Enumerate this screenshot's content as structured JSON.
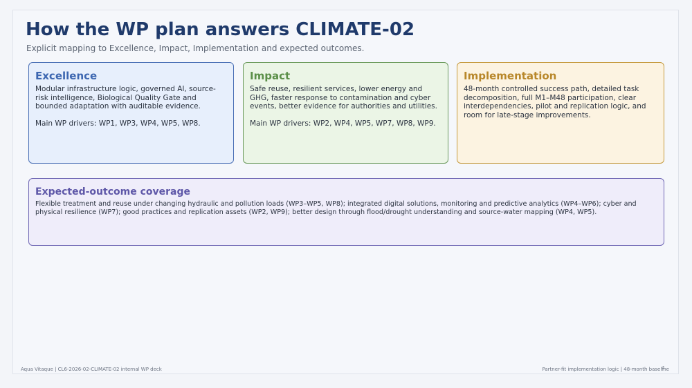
{
  "slide": {
    "title": "How the WP plan answers CLIMATE-02",
    "subtitle": "Explicit mapping to Excellence, Impact, Implementation and expected outcomes."
  },
  "cards": {
    "excellence": {
      "heading": "Excellence",
      "body": "Modular infrastructure logic, governed AI, source-risk intelligence, Biological Quality Gate and bounded adaptation with auditable evidence.",
      "drivers": "Main WP drivers: WP1, WP3, WP4, WP5, WP8.",
      "accent": "#3d67b1"
    },
    "impact": {
      "heading": "Impact",
      "body": "Safe reuse, resilient services, lower energy and GHG, faster response to contamination and cyber events, better evidence for authorities and utilities.",
      "drivers": "Main WP drivers: WP2, WP4, WP5, WP7, WP8, WP9.",
      "accent": "#5b8f48"
    },
    "implementation": {
      "heading": "Implementation",
      "body": "48-month controlled success path, detailed task decomposition, full M1–M48 participation, clear interdependencies, pilot and replication logic, and room for late-stage improvements.",
      "accent": "#b8872a"
    },
    "outcome": {
      "heading": "Expected-outcome coverage",
      "body": "Flexible treatment and reuse under changing hydraulic and pollution loads (WP3–WP5, WP8); integrated digital solutions, monitoring and predictive analytics (WP4–WP6); cyber and physical resilience (WP7); good practices and replication assets (WP2, WP9); better design through flood/drought understanding and source-water mapping (WP4, WP5).",
      "accent": "#5e57a8"
    }
  },
  "footer": {
    "left": "Aqua Vitaque | CL6-2026-02-CLIMATE-02 internal WP deck",
    "right": "Partner-fit implementation logic | 48-month baseline",
    "page_number": "4"
  }
}
